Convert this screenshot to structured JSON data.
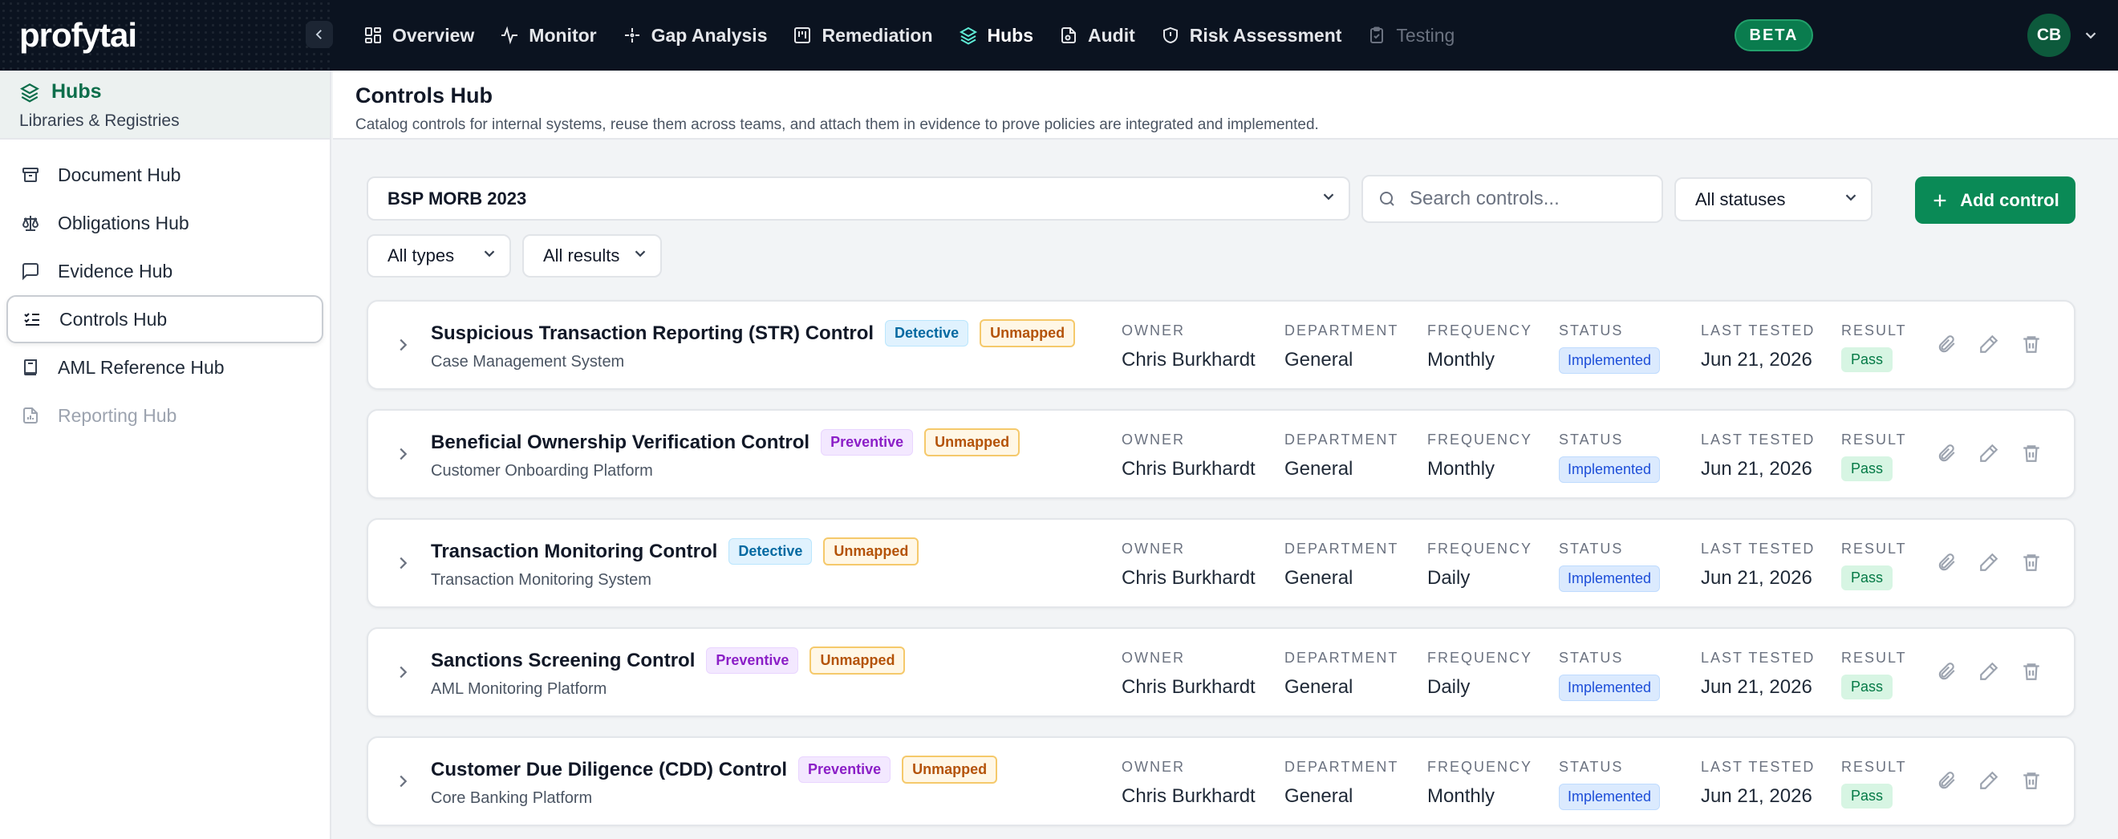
{
  "app": {
    "logo": "profytai"
  },
  "nav": {
    "items": [
      {
        "label": "Overview",
        "icon": "layout-grid-icon"
      },
      {
        "label": "Monitor",
        "icon": "activity-icon"
      },
      {
        "label": "Gap Analysis",
        "icon": "sparkle-icon"
      },
      {
        "label": "Remediation",
        "icon": "kanban-icon"
      },
      {
        "label": "Hubs",
        "icon": "layers-icon",
        "active": true
      },
      {
        "label": "Audit",
        "icon": "file-search-icon"
      },
      {
        "label": "Risk Assessment",
        "icon": "shield-icon"
      },
      {
        "label": "Testing",
        "icon": "clipboard-icon",
        "disabled": true
      }
    ],
    "beta": "BETA",
    "avatar": "CB"
  },
  "sidebar": {
    "title": "Hubs",
    "subtitle": "Libraries & Registries",
    "items": [
      {
        "label": "Document Hub",
        "icon": "archive-icon"
      },
      {
        "label": "Obligations Hub",
        "icon": "scale-icon"
      },
      {
        "label": "Evidence Hub",
        "icon": "message-square-icon"
      },
      {
        "label": "Controls Hub",
        "icon": "list-checks-icon",
        "active": true
      },
      {
        "label": "AML Reference Hub",
        "icon": "book-icon"
      },
      {
        "label": "Reporting Hub",
        "icon": "file-chart-icon",
        "disabled": true
      }
    ]
  },
  "page": {
    "title": "Controls Hub",
    "description": "Catalog controls for internal systems, reuse them across teams, and attach them in evidence to prove policies are integrated and implemented."
  },
  "filters": {
    "framework": "BSP MORB 2023",
    "search_placeholder": "Search controls...",
    "status": "All statuses",
    "type": "All types",
    "result": "All results",
    "add_label": "Add control"
  },
  "columns": {
    "owner": "OWNER",
    "department": "DEPARTMENT",
    "frequency": "FREQUENCY",
    "status": "STATUS",
    "last_tested": "LAST TESTED",
    "result": "RESULT"
  },
  "controls": [
    {
      "name": "Suspicious Transaction Reporting (STR) Control",
      "type": "Detective",
      "mapping": "Unmapped",
      "system": "Case Management System",
      "owner": "Chris Burkhardt",
      "department": "General",
      "frequency": "Monthly",
      "status": "Implemented",
      "last_tested": "Jun 21, 2026",
      "result": "Pass"
    },
    {
      "name": "Beneficial Ownership Verification Control",
      "type": "Preventive",
      "mapping": "Unmapped",
      "system": "Customer Onboarding Platform",
      "owner": "Chris Burkhardt",
      "department": "General",
      "frequency": "Monthly",
      "status": "Implemented",
      "last_tested": "Jun 21, 2026",
      "result": "Pass"
    },
    {
      "name": "Transaction Monitoring Control",
      "type": "Detective",
      "mapping": "Unmapped",
      "system": "Transaction Monitoring System",
      "owner": "Chris Burkhardt",
      "department": "General",
      "frequency": "Daily",
      "status": "Implemented",
      "last_tested": "Jun 21, 2026",
      "result": "Pass"
    },
    {
      "name": "Sanctions Screening Control",
      "type": "Preventive",
      "mapping": "Unmapped",
      "system": "AML Monitoring Platform",
      "owner": "Chris Burkhardt",
      "department": "General",
      "frequency": "Daily",
      "status": "Implemented",
      "last_tested": "Jun 21, 2026",
      "result": "Pass"
    },
    {
      "name": "Customer Due Diligence (CDD) Control",
      "type": "Preventive",
      "mapping": "Unmapped",
      "system": "Core Banking Platform",
      "owner": "Chris Burkhardt",
      "department": "General",
      "frequency": "Monthly",
      "status": "Implemented",
      "last_tested": "Jun 21, 2026",
      "result": "Pass"
    }
  ],
  "colors": {
    "brand": "#0a8a56",
    "nav_bg": "#0b1320",
    "sidebar_accent": "#0d6e4b"
  }
}
